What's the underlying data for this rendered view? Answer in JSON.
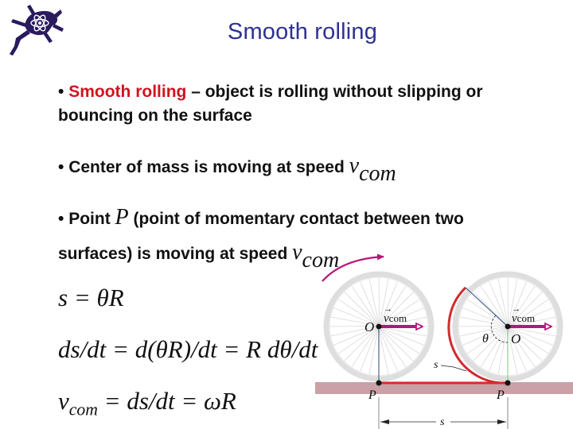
{
  "slide": {
    "title": "Smooth rolling",
    "logo": "horned-lizard-atom-logo",
    "bullets": [
      {
        "marker": "•",
        "highlight": "Smooth rolling",
        "text": " – object is rolling without slipping or",
        "continuation": "bouncing on the surface"
      },
      {
        "marker": "•",
        "text": "Center of mass is moving at speed ",
        "math_var": "v",
        "math_sub": "com"
      },
      {
        "marker": "•",
        "text_before": "Point ",
        "point_var": "P",
        "text_after": " (point of momentary contact between two",
        "line2_text": "surfaces) is moving at speed ",
        "math_var": "v",
        "math_sub": "com"
      }
    ],
    "equations": [
      {
        "text": "s = θR"
      },
      {
        "text": "ds/dt = d(θR)/dt = R dθ/dt"
      },
      {
        "lhs_var": "v",
        "lhs_sub": "com",
        "rhs": " = ds/dt = ωR"
      }
    ]
  },
  "diagram": {
    "labels": {
      "center": "O",
      "contact": "P",
      "angle": "θ",
      "arc": "s",
      "distance": "s",
      "velocity_arrow": "→",
      "velocity_var": "v",
      "velocity_sub": "com"
    },
    "colors": {
      "title": "#2e3192",
      "highlight_red": "#d0141e",
      "arc_red": "#d42a2f",
      "velocity_magenta": "#b5177a",
      "ground": "#c9a1a6",
      "wheel_rim": "#dcdcdc",
      "radius_blue": "#2a4f86",
      "radius_green": "#7fc97f"
    }
  }
}
